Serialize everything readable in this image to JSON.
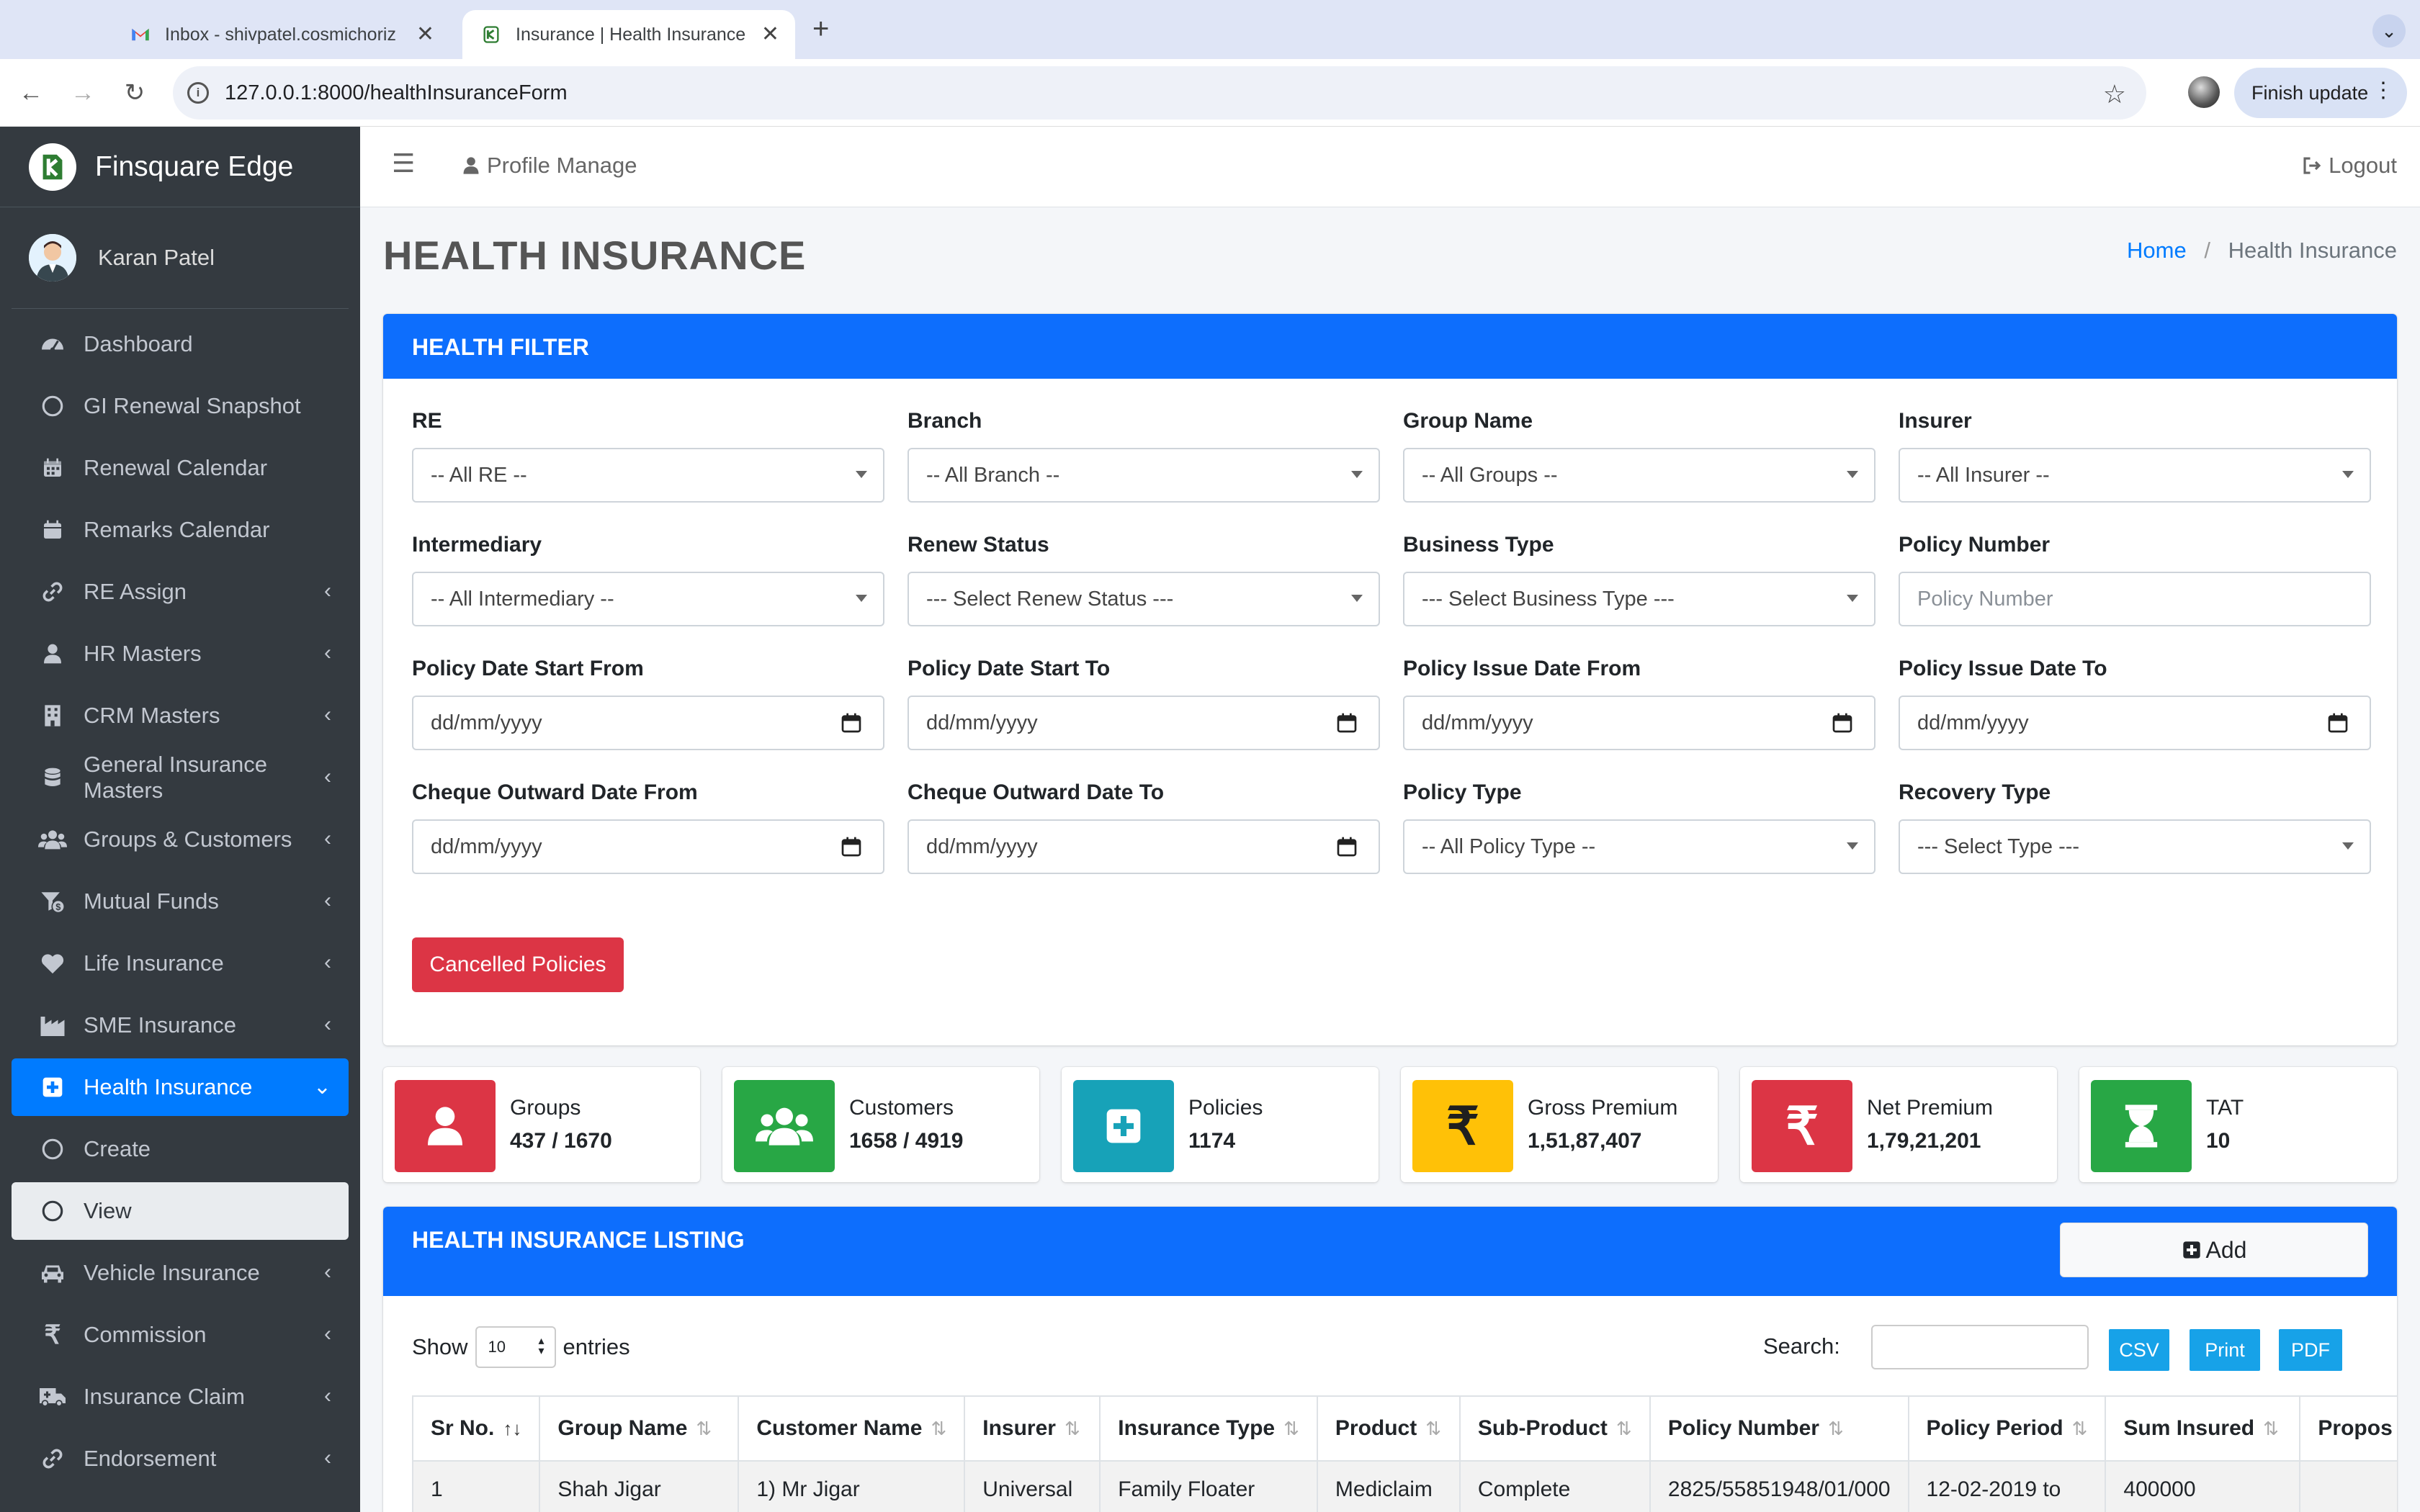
{
  "browser": {
    "tabs": [
      {
        "title": "Inbox - shivpatel.cosmichoriz"
      },
      {
        "title": "Insurance | Health Insurance"
      }
    ],
    "url": "127.0.0.1:8000/healthInsuranceForm",
    "finish_update_label": "Finish update"
  },
  "sidebar": {
    "brand": "Finsquare Edge",
    "user_name": "Karan Patel",
    "items": [
      {
        "label": "Dashboard",
        "icon": "dashboard-icon"
      },
      {
        "label": "GI Renewal Snapshot",
        "icon": "circle-icon"
      },
      {
        "label": "Renewal Calendar",
        "icon": "calendar-icon"
      },
      {
        "label": "Remarks Calendar",
        "icon": "calendar-icon"
      },
      {
        "label": "RE Assign",
        "icon": "link-icon"
      },
      {
        "label": "HR Masters",
        "icon": "user-icon"
      },
      {
        "label": "CRM Masters",
        "icon": "building-icon"
      },
      {
        "label": "General Insurance Masters",
        "icon": "database-icon"
      },
      {
        "label": "Groups & Customers",
        "icon": "users-icon"
      },
      {
        "label": "Mutual Funds",
        "icon": "funnel-dollar-icon"
      },
      {
        "label": "Life Insurance",
        "icon": "heart-icon"
      },
      {
        "label": "SME Insurance",
        "icon": "industry-icon"
      },
      {
        "label": "Health Insurance",
        "icon": "plus-square-icon"
      },
      {
        "label": "Create",
        "icon": "circle-icon"
      },
      {
        "label": "View",
        "icon": "circle-icon"
      },
      {
        "label": "Vehicle Insurance",
        "icon": "car-icon"
      },
      {
        "label": "Commission",
        "icon": "rupee-icon"
      },
      {
        "label": "Insurance Claim",
        "icon": "ambulance-icon"
      },
      {
        "label": "Endorsement",
        "icon": "link-icon"
      }
    ]
  },
  "header": {
    "profile_manage": "Profile Manage",
    "logout": "Logout"
  },
  "page": {
    "title": "HEALTH INSURANCE",
    "breadcrumb_home": "Home",
    "breadcrumb_sep": "/",
    "breadcrumb_current": "Health Insurance"
  },
  "filter": {
    "title": "HEALTH FILTER",
    "fields": [
      {
        "label": "RE",
        "value": "-- All RE --",
        "kind": "select"
      },
      {
        "label": "Branch",
        "value": "-- All Branch --",
        "kind": "select"
      },
      {
        "label": "Group Name",
        "value": "-- All Groups --",
        "kind": "select"
      },
      {
        "label": "Insurer",
        "value": "-- All Insurer --",
        "kind": "select"
      },
      {
        "label": "Intermediary",
        "value": "-- All Intermediary --",
        "kind": "select"
      },
      {
        "label": "Renew Status",
        "value": "--- Select Renew Status ---",
        "kind": "select"
      },
      {
        "label": "Business Type",
        "value": "--- Select Business Type ---",
        "kind": "select"
      },
      {
        "label": "Policy Number",
        "placeholder": "Policy Number",
        "kind": "text"
      },
      {
        "label": "Policy Date Start From",
        "value": "dd/mm/yyyy",
        "kind": "date"
      },
      {
        "label": "Policy Date Start To",
        "value": "dd/mm/yyyy",
        "kind": "date"
      },
      {
        "label": "Policy Issue Date From",
        "value": "dd/mm/yyyy",
        "kind": "date"
      },
      {
        "label": "Policy Issue Date To",
        "value": "dd/mm/yyyy",
        "kind": "date"
      },
      {
        "label": "Cheque Outward Date From",
        "value": "dd/mm/yyyy",
        "kind": "date"
      },
      {
        "label": "Cheque Outward Date To",
        "value": "dd/mm/yyyy",
        "kind": "date"
      },
      {
        "label": "Policy Type",
        "value": "-- All Policy Type --",
        "kind": "select"
      },
      {
        "label": "Recovery Type",
        "value": "--- Select Type ---",
        "kind": "select"
      }
    ],
    "cancelled_button": "Cancelled Policies"
  },
  "stats": [
    {
      "label": "Groups",
      "value": "437 / 1670",
      "color": "#dc3545",
      "icon": "user-icon"
    },
    {
      "label": "Customers",
      "value": "1658 / 4919",
      "color": "#28a745",
      "icon": "users-icon"
    },
    {
      "label": "Policies",
      "value": "1174",
      "color": "#17a2b8",
      "icon": "plus-square-icon"
    },
    {
      "label": "Gross Premium",
      "value": "1,51,87,407",
      "color": "#ffc107",
      "icon": "rupee-icon"
    },
    {
      "label": "Net Premium",
      "value": "1,79,21,201",
      "color": "#dc3545",
      "icon": "rupee-icon"
    },
    {
      "label": "TAT",
      "value": "10",
      "color": "#28a745",
      "icon": "hourglass-icon"
    }
  ],
  "listing": {
    "title": "HEALTH INSURANCE LISTING",
    "add_label": "Add",
    "show_label": "Show",
    "page_length": "10",
    "entries_label": "entries",
    "search_label": "Search:",
    "export_buttons": [
      "CSV",
      "Print",
      "PDF"
    ],
    "columns": [
      "Sr No.",
      "Group Name",
      "Customer Name",
      "Insurer",
      "Insurance Type",
      "Product",
      "Sub-Product",
      "Policy Number",
      "Policy Period",
      "Sum Insured",
      "Propos"
    ],
    "rows": [
      [
        "1",
        "Shah Jigar",
        "1) Mr Jigar",
        "Universal",
        "Family Floater",
        "Mediclaim",
        "Complete",
        "2825/55851948/01/000",
        "12-02-2019 to",
        "400000",
        ""
      ]
    ]
  }
}
